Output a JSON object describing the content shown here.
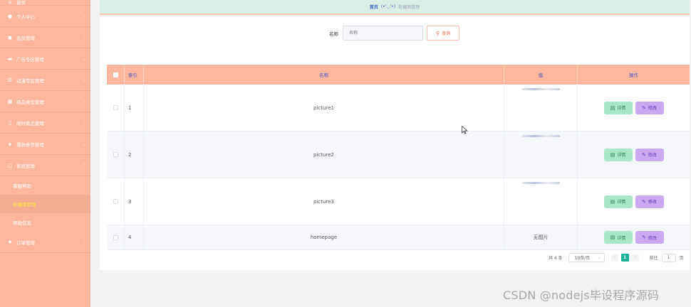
{
  "sidebar": {
    "items": [
      {
        "label": "首页",
        "icon": "home-icon",
        "glyph": "⌂"
      },
      {
        "label": "个人中心",
        "icon": "user-icon",
        "glyph": "●",
        "chevron": "⌄"
      },
      {
        "label": "会员管理",
        "icon": "member-icon",
        "glyph": "◼",
        "chevron": "⌄"
      },
      {
        "label": "广告专区管理",
        "icon": "monitor-icon",
        "glyph": "▬",
        "chevron": "⌄"
      },
      {
        "label": "动漫专区管理",
        "icon": "list-icon",
        "glyph": "☰",
        "chevron": "⌄"
      },
      {
        "label": "商品类型管理",
        "icon": "grid-icon",
        "glyph": "▦",
        "chevron": "⌄"
      },
      {
        "label": "限时商品管理",
        "icon": "phone-icon",
        "glyph": "▯",
        "chevron": "⌄"
      },
      {
        "label": "爆款推荐管理",
        "icon": "tag-icon",
        "glyph": "◈",
        "chevron": "⌄"
      },
      {
        "label": "系统管理",
        "icon": "chat-icon",
        "glyph": "▢",
        "chevron": "⌃"
      }
    ],
    "sub_items": [
      {
        "label": "客服帮助"
      },
      {
        "label": "轮播图管理"
      },
      {
        "label": "帮助信息"
      }
    ],
    "last_item": {
      "label": "订单管理",
      "icon": "bulb-icon",
      "glyph": "♦",
      "chevron": "⌄"
    }
  },
  "breadcrumb": {
    "home": "首页",
    "face": "(•'◡'•)",
    "current": "轮播图管理"
  },
  "search": {
    "label": "名称",
    "placeholder": "名称",
    "button_label": "查询"
  },
  "table": {
    "headers": {
      "index": "索引",
      "name": "名称",
      "value": "值",
      "action": "操作"
    },
    "rows": [
      {
        "index": "1",
        "name": "picture1",
        "value": ""
      },
      {
        "index": "2",
        "name": "picture2",
        "value": ""
      },
      {
        "index": "3",
        "name": "picture3",
        "value": ""
      },
      {
        "index": "4",
        "name": "homepage",
        "value": "无图片"
      }
    ],
    "detail_label": "详情",
    "edit_label": "修改"
  },
  "pagination": {
    "total": "共 4 条",
    "page_size": "10条/页",
    "current_page": "1",
    "goto_label": "前往",
    "goto_value": "1",
    "unit": "页"
  },
  "watermark": "CSDN @nodejs毕设程序源码"
}
